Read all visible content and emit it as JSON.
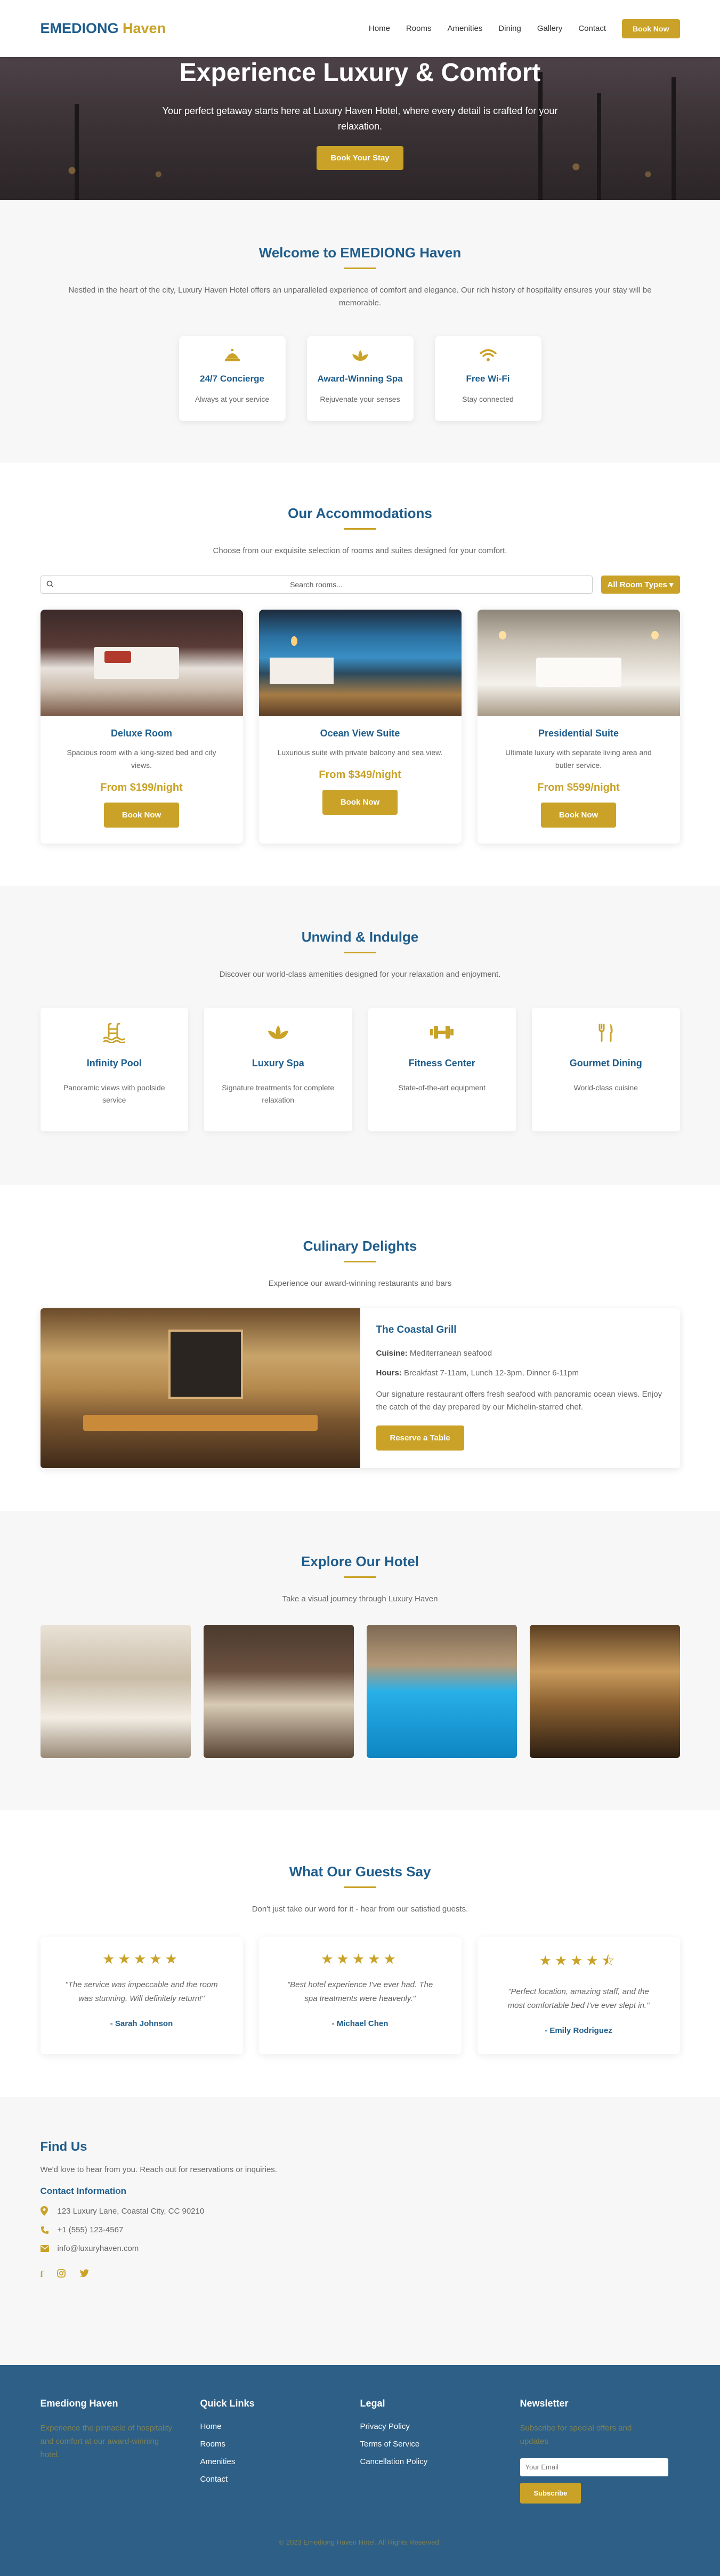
{
  "nav": {
    "logo_main": "EMEDIONG",
    "logo_accent": "Haven",
    "links": [
      "Home",
      "Rooms",
      "Amenities",
      "Dining",
      "Gallery",
      "Contact"
    ],
    "book_label": "Book Now"
  },
  "hero": {
    "title": "Experience Luxury & Comfort",
    "subtitle": "Your perfect getaway starts here at Luxury Haven Hotel, where every detail is crafted for your relaxation.",
    "cta": "Book Your Stay"
  },
  "welcome": {
    "title": "Welcome to EMEDIONG Haven",
    "text": "Nestled in the heart of the city, Luxury Haven Hotel offers an unparalleled experience of comfort and elegance. Our rich history of hospitality ensures your stay will be memorable.",
    "features": [
      {
        "icon": "concierge-bell-icon",
        "title": "24/7 Concierge",
        "text": "Always at your service"
      },
      {
        "icon": "spa-lotus-icon",
        "title": "Award-Winning Spa",
        "text": "Rejuvenate your senses"
      },
      {
        "icon": "wifi-icon",
        "title": "Free Wi-Fi",
        "text": "Stay connected"
      }
    ]
  },
  "rooms": {
    "title": "Our Accommodations",
    "subtitle": "Choose from our exquisite selection of rooms and suites designed for your comfort.",
    "search_placeholder": "Search rooms...",
    "filter_label": "All Room Types ▾",
    "items": [
      {
        "name": "Deluxe Room",
        "desc": "Spacious room with a king-sized bed and city views.",
        "price": "From $199/night",
        "button": "Book Now"
      },
      {
        "name": "Ocean View Suite",
        "desc": "Luxurious suite with private balcony and sea view.",
        "price": "From $349/night",
        "button": "Book Now"
      },
      {
        "name": "Presidential Suite",
        "desc": "Ultimate luxury with separate living area and butler service.",
        "price": "From $599/night",
        "button": "Book Now"
      }
    ]
  },
  "amenities": {
    "title": "Unwind & Indulge",
    "subtitle": "Discover our world-class amenities designed for your relaxation and enjoyment.",
    "items": [
      {
        "icon": "pool-ladder-icon",
        "title": "Infinity Pool",
        "text": "Panoramic views with poolside service"
      },
      {
        "icon": "spa-lotus-icon",
        "title": "Luxury Spa",
        "text": "Signature treatments for complete relaxation"
      },
      {
        "icon": "dumbbell-icon",
        "title": "Fitness Center",
        "text": "State-of-the-art equipment"
      },
      {
        "icon": "fork-knife-icon",
        "title": "Gourmet Dining",
        "text": "World-class cuisine"
      }
    ]
  },
  "dining": {
    "title": "Culinary Delights",
    "subtitle": "Experience our award-winning restaurants and bars",
    "name": "The Coastal Grill",
    "cuisine_label": "Cuisine:",
    "cuisine": "Mediterranean seafood",
    "hours_label": "Hours:",
    "hours": "Breakfast 7-11am, Lunch 12-3pm, Dinner 6-11pm",
    "desc": "Our signature restaurant offers fresh seafood with panoramic ocean views. Enjoy the catch of the day prepared by our Michelin-starred chef.",
    "cta": "Reserve a Table"
  },
  "gallery": {
    "title": "Explore Our Hotel",
    "subtitle": "Take a visual journey through Luxury Haven"
  },
  "testimonials": {
    "title": "What Our Guests Say",
    "subtitle": "Don't just take our word for it - hear from our satisfied guests.",
    "items": [
      {
        "stars": "★★★★★",
        "rating": 5,
        "quote": "\"The service was impeccable and the room was stunning. Will definitely return!\"",
        "name": "- Sarah Johnson"
      },
      {
        "stars": "★★★★★",
        "rating": 5,
        "quote": "\"Best hotel experience I've ever had. The spa treatments were heavenly.\"",
        "name": "- Michael Chen"
      },
      {
        "stars": "★★★★⯪",
        "rating": 4.5,
        "quote": "\"Perfect location, amazing staff, and the most comfortable bed I've ever slept in.\"",
        "name": "- Emily Rodriguez"
      }
    ]
  },
  "contact": {
    "title": "Find Us",
    "lead": "We'd love to hear from you. Reach out for reservations or inquiries.",
    "info_title": "Contact Information",
    "address": "123 Luxury Lane, Coastal City, CC 90210",
    "phone": "+1 (555) 123-4567",
    "email": "info@luxuryhaven.com"
  },
  "footer": {
    "brand_title": "Emediong Haven",
    "brand_text": "Experience the pinnacle of hospitality and comfort at our award-winning hotel.",
    "quick_title": "Quick Links",
    "quick_links": [
      "Home",
      "Rooms",
      "Amenities",
      "Contact"
    ],
    "legal_title": "Legal",
    "legal_links": [
      "Privacy Policy",
      "Terms of Service",
      "Cancellation Policy"
    ],
    "news_title": "Newsletter",
    "news_text": "Subscribe for special offers and updates",
    "email_placeholder": "Your Email",
    "subscribe": "Subscribe",
    "copyright": "© 2023 Emediong Haven Hotel. All Rights Reserved."
  },
  "colors": {
    "primary": "#1f5d8c",
    "accent": "#c9a227",
    "footer": "#2d5f87"
  }
}
